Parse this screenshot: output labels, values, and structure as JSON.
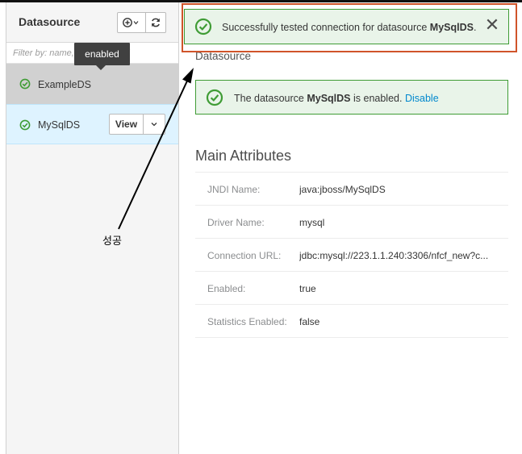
{
  "left_panel": {
    "title": "Datasource",
    "filter_placeholder": "Filter by: name, enabled, depl",
    "tooltip": "enabled",
    "items": [
      {
        "label": "ExampleDS",
        "status_icon": "check-circle-icon"
      },
      {
        "label": "MySqlDS",
        "status_icon": "check-circle-icon",
        "view_label": "View"
      }
    ],
    "icons": [
      "add-circle-icon",
      "chevron-down-icon",
      "refresh-icon"
    ]
  },
  "toast": {
    "prefix": "Successfully tested connection for datasource ",
    "name": "MySqlDS",
    "suffix": ".",
    "close": "✕"
  },
  "main": {
    "breadcrumb": "Datasource",
    "alert": {
      "prefix": "The datasource ",
      "name": "MySqlDS",
      "middle": " is enabled. ",
      "link": "Disable"
    },
    "section_title": "Main Attributes",
    "attributes": [
      {
        "key": "JNDI Name:",
        "value": "java:jboss/MySqlDS"
      },
      {
        "key": "Driver Name:",
        "value": "mysql"
      },
      {
        "key": "Connection URL:",
        "value": "jdbc:mysql://223.1.1.240:3306/nfcf_new?c..."
      },
      {
        "key": "Enabled:",
        "value": "true"
      },
      {
        "key": "Statistics Enabled:",
        "value": "false"
      }
    ]
  },
  "annotation": {
    "label": "성공"
  },
  "colors": {
    "success_green": "#3f9c35",
    "success_bg": "#e9f4e9",
    "highlight_frame": "#d0542a",
    "selected_row": "#def3ff",
    "link": "#0088ce"
  }
}
